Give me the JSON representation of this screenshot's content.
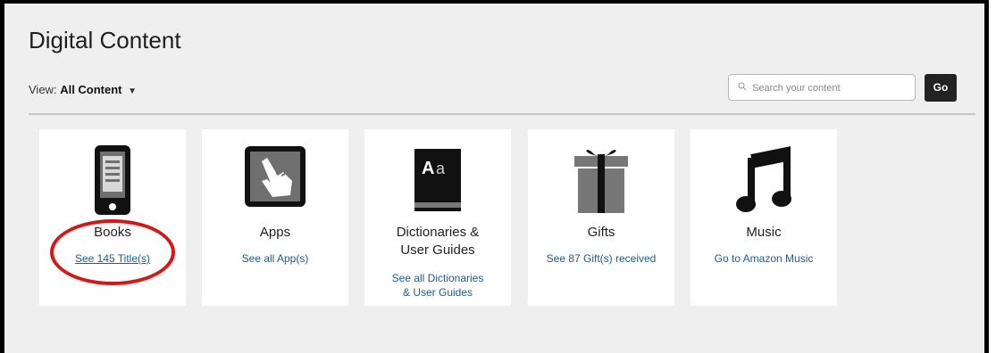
{
  "page": {
    "title": "Digital Content"
  },
  "view": {
    "prefix": "View:",
    "selected": "All Content"
  },
  "search": {
    "placeholder": "Search your content",
    "go_label": "Go"
  },
  "cards": [
    {
      "label": "Books",
      "link": "See 145 Title(s)",
      "icon": "ereader-icon"
    },
    {
      "label": "Apps",
      "link": "See all App(s)",
      "icon": "touch-hand-icon"
    },
    {
      "label": "Dictionaries &\nUser Guides",
      "link": "See all Dictionaries\n& User Guides",
      "icon": "dictionary-icon"
    },
    {
      "label": "Gifts",
      "link": "See 87 Gift(s) received",
      "icon": "gift-icon"
    },
    {
      "label": "Music",
      "link": "Go to Amazon Music",
      "icon": "music-note-icon"
    }
  ],
  "colors": {
    "link": "#1a5d99",
    "highlight": "#e31212",
    "background": "#efefef"
  }
}
